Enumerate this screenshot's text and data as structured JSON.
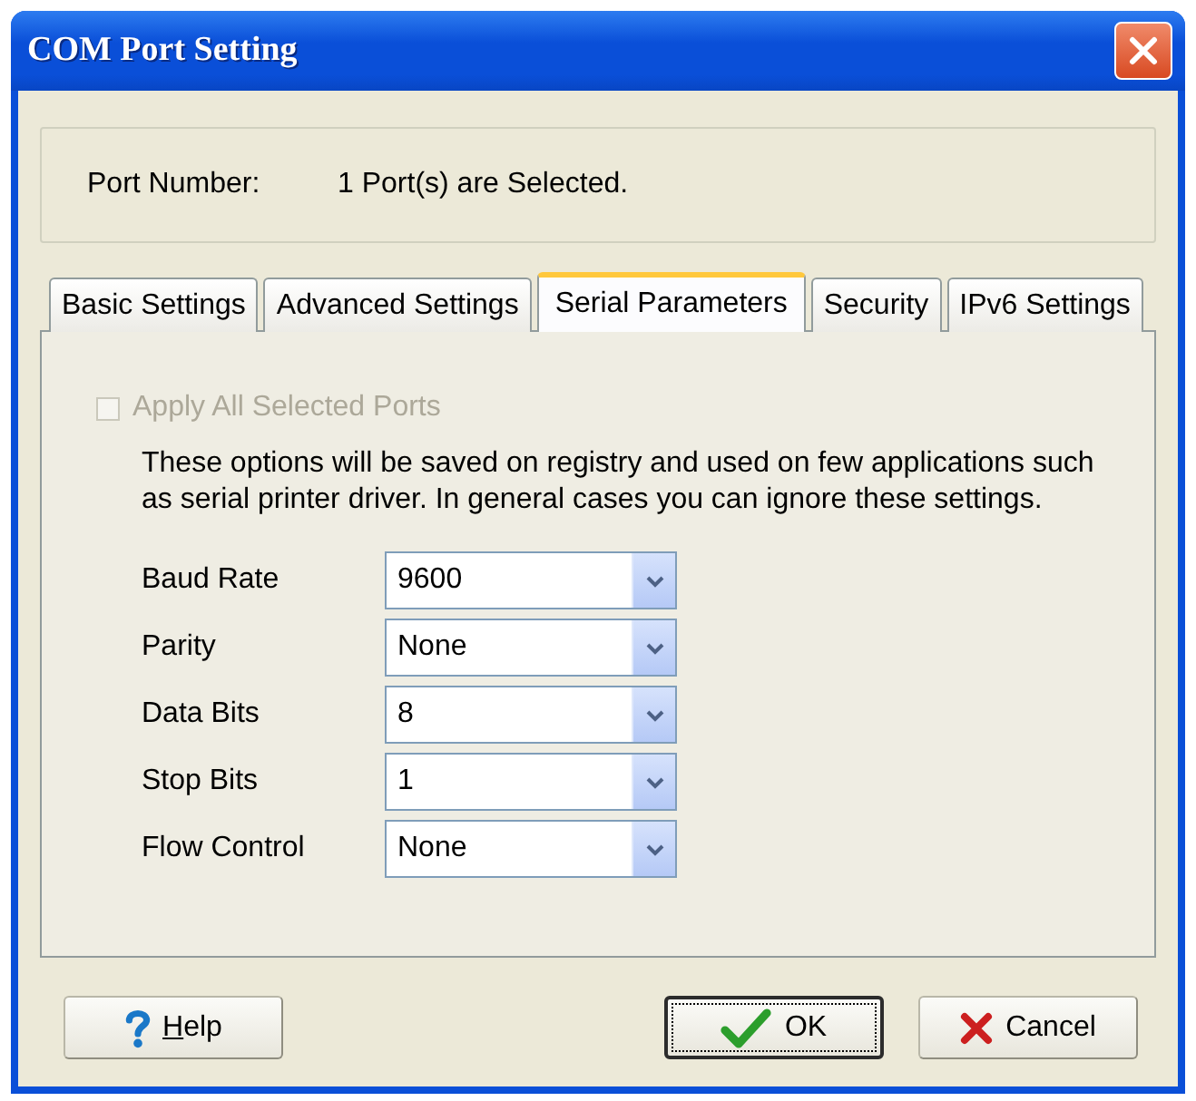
{
  "window": {
    "title": "COM Port Setting"
  },
  "port_number": {
    "label": "Port Number:",
    "value": "1 Port(s) are Selected."
  },
  "tabs": [
    {
      "label": "Basic Settings",
      "selected": false
    },
    {
      "label": "Advanced Settings",
      "selected": false
    },
    {
      "label": "Serial Parameters",
      "selected": true
    },
    {
      "label": "Security",
      "selected": false
    },
    {
      "label": "IPv6 Settings",
      "selected": false
    }
  ],
  "apply_all": {
    "label": "Apply All Selected Ports",
    "checked": false,
    "disabled": true
  },
  "description": "These options will be saved on registry and used on few applications such as serial printer driver. In general cases you can ignore these settings.",
  "fields": [
    {
      "label": "Baud Rate",
      "value": "9600"
    },
    {
      "label": "Parity",
      "value": "None"
    },
    {
      "label": "Data Bits",
      "value": "8"
    },
    {
      "label": "Stop Bits",
      "value": "1"
    },
    {
      "label": "Flow Control",
      "value": "None"
    }
  ],
  "buttons": [
    {
      "kind": "help",
      "label": "Help",
      "underline_first": true,
      "default": false
    },
    {
      "kind": "ok",
      "label": "OK",
      "underline_first": false,
      "default": true
    },
    {
      "kind": "cancel",
      "label": "Cancel",
      "underline_first": false,
      "default": false
    }
  ]
}
